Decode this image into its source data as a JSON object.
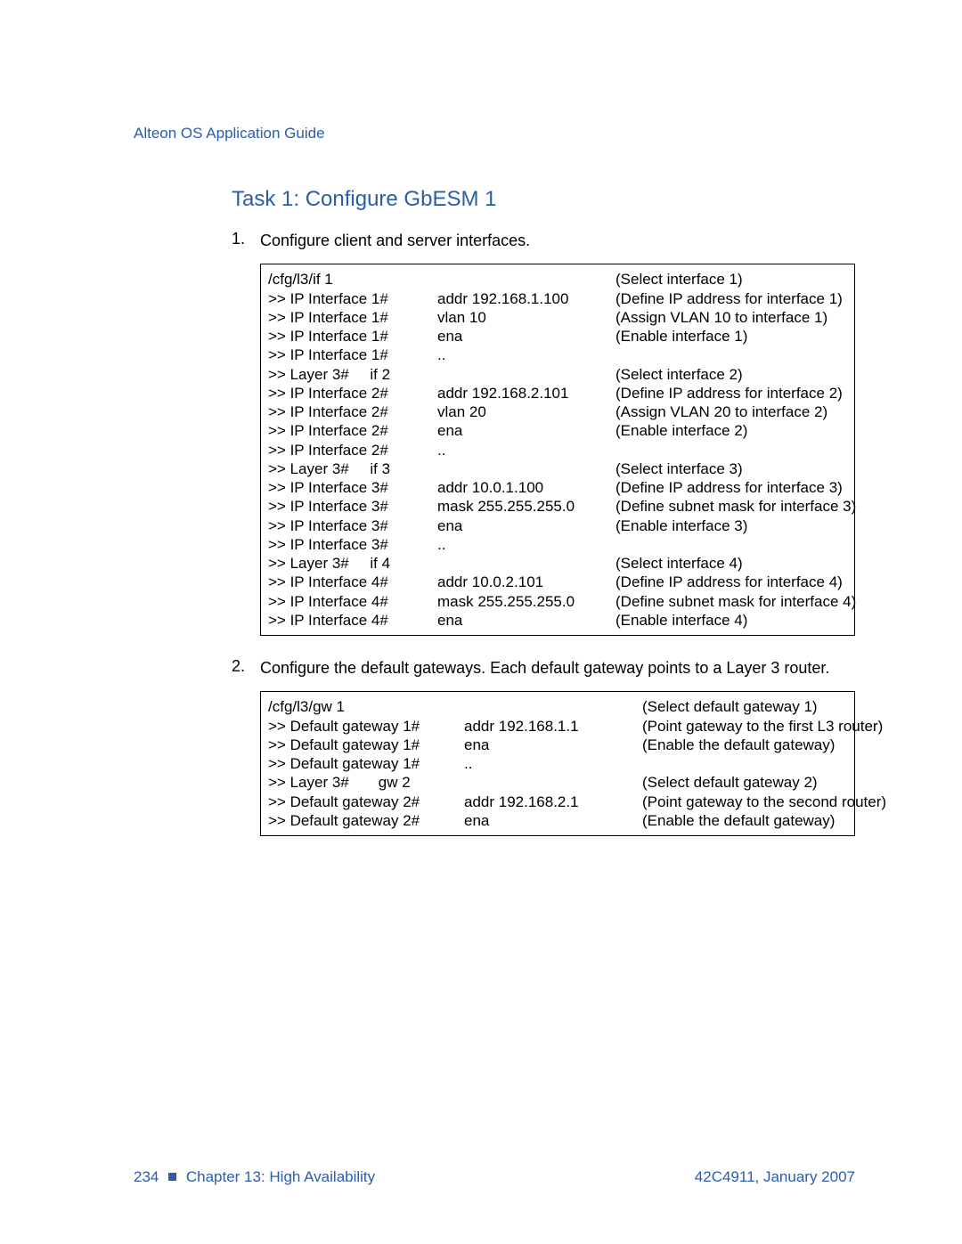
{
  "header": {
    "doc_title": "Alteon OS Application Guide"
  },
  "task": {
    "heading": "Task 1: Configure GbESM 1"
  },
  "steps": {
    "s1": {
      "num": "1.",
      "text": "Configure client and server interfaces."
    },
    "s2": {
      "num": "2.",
      "text": "Configure the default gateways. Each default gateway points to a Layer 3 router."
    }
  },
  "box1": {
    "r0": {
      "a": "/cfg/l3/if 1",
      "b": "",
      "c": "(Select interface 1)"
    },
    "r1": {
      "a": ">> IP Interface 1#",
      "b": "addr 192.168.1.100",
      "c": "(Define IP address for interface 1)"
    },
    "r2": {
      "a": ">> IP Interface 1#",
      "b": "vlan 10",
      "c": "(Assign VLAN 10 to interface 1)"
    },
    "r3": {
      "a": ">> IP Interface 1#",
      "b": "ena",
      "c": "(Enable interface 1)"
    },
    "r4": {
      "a": ">> IP Interface 1#",
      "b": "..",
      "c": ""
    },
    "r5": {
      "a": ">> Layer 3#     if 2",
      "b": "",
      "c": "(Select interface 2)"
    },
    "r6": {
      "a": ">> IP Interface 2#",
      "b": "addr 192.168.2.101",
      "c": "(Define IP address for interface 2)"
    },
    "r7": {
      "a": ">> IP Interface 2#",
      "b": "vlan 20",
      "c": "(Assign VLAN 20 to interface 2)"
    },
    "r8": {
      "a": ">> IP Interface 2#",
      "b": "ena",
      "c": "(Enable interface 2)"
    },
    "r9": {
      "a": ">> IP Interface 2#",
      "b": "..",
      "c": ""
    },
    "r10": {
      "a": ">> Layer 3#     if 3",
      "b": "",
      "c": "(Select interface 3)"
    },
    "r11": {
      "a": ">> IP Interface 3#",
      "b": "addr 10.0.1.100",
      "c": "(Define IP address for interface 3)"
    },
    "r12": {
      "a": ">> IP Interface 3#",
      "b": "mask 255.255.255.0",
      "c": "(Define subnet mask for interface 3)"
    },
    "r13": {
      "a": ">> IP Interface 3#",
      "b": "ena",
      "c": "(Enable interface 3)"
    },
    "r14": {
      "a": ">> IP Interface 3#",
      "b": "..",
      "c": ""
    },
    "r15": {
      "a": ">> Layer 3#     if 4",
      "b": "",
      "c": "(Select interface 4)"
    },
    "r16": {
      "a": ">> IP Interface 4#",
      "b": "addr 10.0.2.101",
      "c": "(Define IP address for interface 4)"
    },
    "r17": {
      "a": ">> IP Interface 4#",
      "b": "mask 255.255.255.0",
      "c": "(Define subnet mask for interface 4)"
    },
    "r18": {
      "a": ">> IP Interface 4#",
      "b": "ena",
      "c": "(Enable interface 4)"
    }
  },
  "box2": {
    "r0": {
      "a": "/cfg/l3/gw 1",
      "b": "",
      "c": "(Select default gateway 1)"
    },
    "r1": {
      "a": ">> Default gateway 1#",
      "b": "addr 192.168.1.1",
      "c": "(Point gateway to the first L3 router)"
    },
    "r2": {
      "a": ">> Default gateway 1#",
      "b": "ena",
      "c": "(Enable the default gateway)"
    },
    "r3": {
      "a": ">> Default gateway 1#",
      "b": "..",
      "c": ""
    },
    "r4": {
      "a": ">> Layer 3#       gw 2",
      "b": "",
      "c": "(Select default gateway 2)"
    },
    "r5": {
      "a": ">> Default gateway 2#",
      "b": "addr 192.168.2.1",
      "c": "(Point gateway to the second router)"
    },
    "r6": {
      "a": ">> Default gateway 2#",
      "b": "ena",
      "c": "(Enable the default gateway)"
    }
  },
  "footer": {
    "page_num": "234",
    "chapter": "Chapter 13:  High Availability",
    "docref": "42C4911, January 2007"
  }
}
